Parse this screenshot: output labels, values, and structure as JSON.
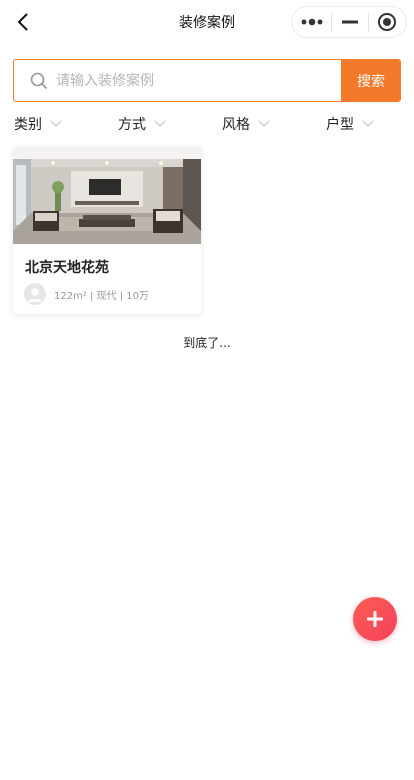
{
  "navbar": {
    "title": "装修案例"
  },
  "search": {
    "placeholder": "请输入装修案例",
    "value": "",
    "button_label": "搜索"
  },
  "filters": [
    {
      "label": "类别"
    },
    {
      "label": "方式"
    },
    {
      "label": "风格"
    },
    {
      "label": "户型"
    }
  ],
  "cases": [
    {
      "title": "北京天地花苑",
      "meta": "122m² | 现代 | 10万"
    }
  ],
  "list_end_text": "到底了...",
  "colors": {
    "accent": "#f47a2b",
    "fab": "#f2425a",
    "muted_text": "#999999"
  },
  "icons": {
    "back": "chevron-left-icon",
    "menu": "more-dots-icon",
    "minimize": "minus-icon",
    "close": "target-circle-icon",
    "search": "search-icon",
    "filter_arrow": "chevron-down-icon",
    "fab": "plus-icon"
  }
}
